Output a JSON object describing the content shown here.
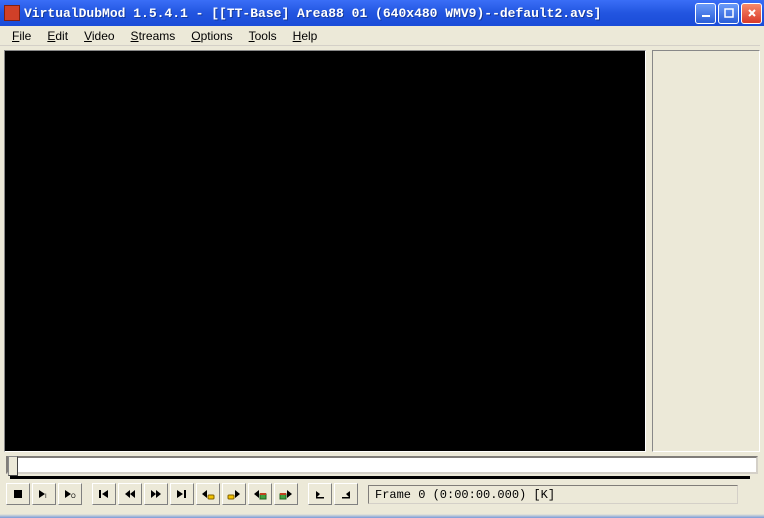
{
  "title": "VirtualDubMod 1.5.4.1 - [[TT-Base] Area88 01 (640x480 WMV9)--default2.avs]",
  "menu": {
    "file": "File",
    "edit": "Edit",
    "video": "Video",
    "streams": "Streams",
    "options": "Options",
    "tools": "Tools",
    "help": "Help"
  },
  "status": "Frame 0 (0:00:00.000) [K]",
  "controls": {
    "stop": "stop",
    "play_in": "play-in",
    "play_out": "play-out",
    "seek_start": "seek-start",
    "step_back": "step-back",
    "step_fwd": "step-fwd",
    "seek_end": "seek-end",
    "key_prev": "key-prev",
    "key_next": "key-next",
    "scene_back": "scene-back",
    "scene_fwd": "scene-fwd",
    "mark_in": "mark-in",
    "mark_out": "mark-out"
  }
}
